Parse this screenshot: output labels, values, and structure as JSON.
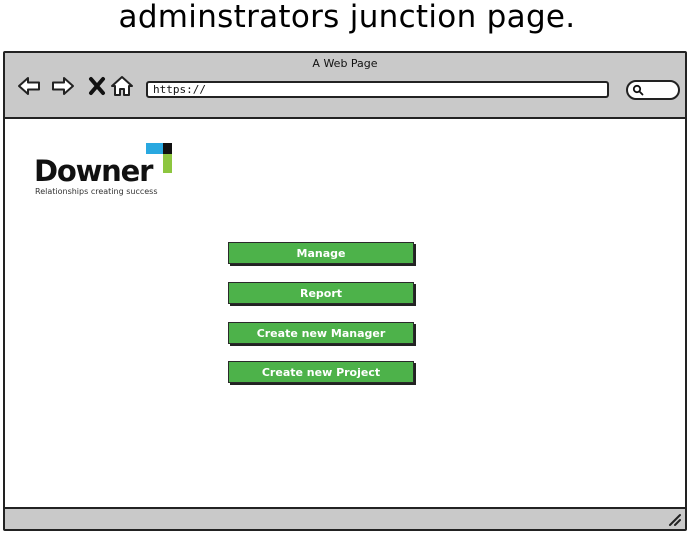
{
  "heading": "adminstrators junction page.",
  "browser": {
    "title": "A Web Page",
    "url": "https://",
    "nav_icons": [
      "back-arrow-icon",
      "forward-arrow-icon",
      "close-icon",
      "home-icon",
      "search-icon"
    ]
  },
  "logo": {
    "wordmark": "Downer",
    "tagline": "Relationships creating success",
    "colors": {
      "cyan": "#29a8e0",
      "black": "#111111",
      "green": "#8dc63f"
    }
  },
  "menu": {
    "manage": "Manage",
    "report": "Report",
    "create_manager": "Create new Manager",
    "create_project": "Create new Project"
  },
  "colors": {
    "button": "#4db24a",
    "chrome": "#c9c9c9"
  }
}
